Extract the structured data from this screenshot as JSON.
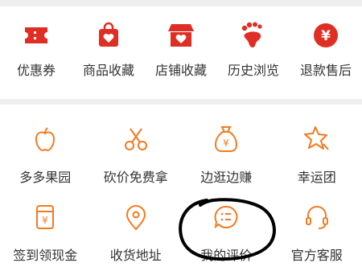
{
  "colors": {
    "red": "#e02e24",
    "orange": "#f47a1f",
    "text": "#333333",
    "background": "#efefef",
    "card": "#ffffff"
  },
  "top_row": [
    {
      "label": "优惠券",
      "icon": "coupon-icon"
    },
    {
      "label": "商品收藏",
      "icon": "bag-heart-icon"
    },
    {
      "label": "店铺收藏",
      "icon": "store-heart-icon"
    },
    {
      "label": "历史浏览",
      "icon": "footprint-icon"
    },
    {
      "label": "退款售后",
      "icon": "yen-circle-icon"
    }
  ],
  "bottom_rows": [
    [
      {
        "label": "多多果园",
        "icon": "apple-icon"
      },
      {
        "label": "砍价免费拿",
        "icon": "scissors-icon"
      },
      {
        "label": "边逛边赚",
        "icon": "money-bag-icon"
      },
      {
        "label": "幸运团",
        "icon": "star-icon"
      }
    ],
    [
      {
        "label": "签到领现金",
        "icon": "checkin-cash-icon"
      },
      {
        "label": "收货地址",
        "icon": "location-pin-icon"
      },
      {
        "label": "我的评价",
        "icon": "comment-list-icon"
      },
      {
        "label": "官方客服",
        "icon": "headset-icon"
      }
    ]
  ]
}
